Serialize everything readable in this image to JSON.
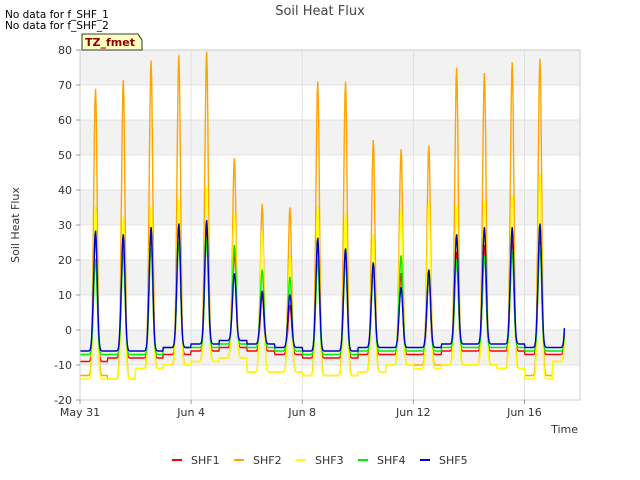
{
  "notes": [
    "No data for f_SHF_1",
    "No data for f_SHF_2"
  ],
  "badge": "TZ_fmet",
  "chart_data": {
    "type": "line",
    "title": "Soil Heat Flux",
    "xlabel": "Time",
    "ylabel": "Soil Heat Flux",
    "ylim": [
      -20,
      80
    ],
    "yticks": [
      -20,
      -10,
      0,
      10,
      20,
      30,
      40,
      50,
      60,
      70,
      80
    ],
    "xlim": [
      "2024-05-31",
      "2024-06-18"
    ],
    "xticks": [
      {
        "date": "2024-05-31",
        "label": "May 31"
      },
      {
        "date": "2024-06-04",
        "label": "Jun 4"
      },
      {
        "date": "2024-06-08",
        "label": "Jun 8"
      },
      {
        "date": "2024-06-12",
        "label": "Jun 12"
      },
      {
        "date": "2024-06-16",
        "label": "Jun 16"
      }
    ],
    "grid": true,
    "legend": "bottom",
    "days": [
      "2024-05-31",
      "2024-06-01",
      "2024-06-02",
      "2024-06-03",
      "2024-06-04",
      "2024-06-05",
      "2024-06-06",
      "2024-06-07",
      "2024-06-08",
      "2024-06-09",
      "2024-06-10",
      "2024-06-11",
      "2024-06-12",
      "2024-06-13",
      "2024-06-14",
      "2024-06-15",
      "2024-06-16",
      "2024-06-17"
    ],
    "series": [
      {
        "name": "SHF1",
        "color": "#ff0000",
        "daily_max": [
          27,
          26,
          27,
          30,
          30,
          22,
          10,
          7,
          25,
          22,
          18,
          16,
          15,
          22,
          24,
          26,
          27,
          27
        ],
        "daily_min": [
          -9,
          -8,
          -8,
          -7,
          -6,
          -5,
          -6,
          -7,
          -8,
          -8,
          -7,
          -7,
          -7,
          -6,
          -6,
          -6,
          -7,
          -7
        ]
      },
      {
        "name": "SHF2",
        "color": "#ffa500",
        "daily_max": [
          68,
          70.5,
          76,
          77.5,
          78.5,
          48.5,
          35.5,
          34.5,
          70,
          70,
          53.5,
          51,
          52,
          74,
          72.5,
          75.5,
          76.5,
          20
        ],
        "daily_min": [
          -13,
          -14,
          -11,
          -10,
          -9,
          -8,
          -12,
          -12,
          -13,
          -13,
          -12,
          -10,
          -10,
          -10,
          -10,
          -11,
          -13,
          -9
        ]
      },
      {
        "name": "SHF3",
        "color": "#ffff00",
        "daily_max": [
          35,
          32,
          35,
          37,
          40,
          33,
          28,
          21,
          35,
          33,
          27,
          34,
          36,
          35,
          36,
          38,
          44,
          20
        ],
        "daily_min": [
          -14,
          -14,
          -11,
          -10,
          -9,
          -8,
          -12,
          -12,
          -13,
          -13,
          -12,
          -10,
          -11,
          -10,
          -10,
          -11,
          -14,
          -9
        ]
      },
      {
        "name": "SHF4",
        "color": "#00ee00",
        "daily_max": [
          20,
          22,
          24,
          25,
          26,
          24,
          17,
          15,
          20,
          20,
          17,
          21,
          16,
          20,
          21,
          22,
          24,
          20
        ],
        "daily_min": [
          -7,
          -7,
          -7,
          -5,
          -5,
          -4,
          -5,
          -6,
          -7,
          -7,
          -6,
          -6,
          -6,
          -5,
          -5,
          -5,
          -6,
          -6
        ]
      },
      {
        "name": "SHF5",
        "color": "#0000cc",
        "daily_max": [
          28,
          27,
          29,
          30,
          31,
          16,
          11,
          10,
          26,
          23,
          19,
          12,
          17,
          27,
          29,
          29,
          30,
          20
        ],
        "daily_min": [
          -6,
          -6,
          -6,
          -5,
          -4,
          -3,
          -4,
          -5,
          -6,
          -6,
          -5,
          -5,
          -5,
          -4,
          -4,
          -4,
          -5,
          -5
        ]
      }
    ]
  }
}
